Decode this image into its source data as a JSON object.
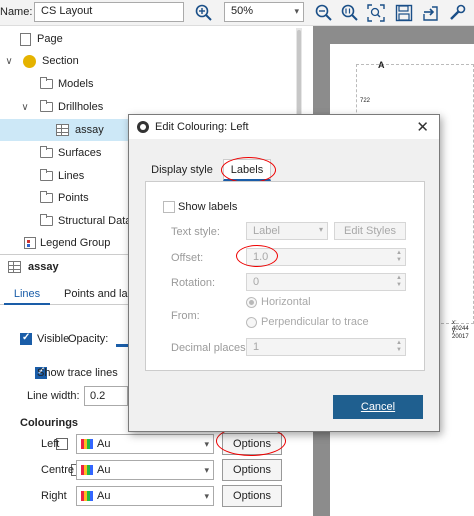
{
  "toolbar": {
    "name_label": "Name:",
    "name_value": "CS Layout",
    "zoom_value": "50%"
  },
  "tree": {
    "page": "Page",
    "section": "Section",
    "models": "Models",
    "drillholes": "Drillholes",
    "assay": "assay",
    "surfaces": "Surfaces",
    "lines": "Lines",
    "points": "Points",
    "structural_data": "Structural Data",
    "legend_group": "Legend Group"
  },
  "props": {
    "title": "assay",
    "tab_lines": "Lines",
    "tab_points": "Points and labels",
    "visible_label": "Visible",
    "opacity_label": "Opacity:",
    "show_trace_label": "Show trace lines",
    "line_width_label": "Line width:",
    "line_width_value": "0.2",
    "colourings_header": "Colourings",
    "rows": [
      {
        "label": "Left",
        "value": "Au",
        "button": "Options"
      },
      {
        "label": "Centre",
        "value": "Au",
        "button": "Options"
      },
      {
        "label": "Right",
        "value": "Au",
        "button": "Options"
      }
    ]
  },
  "view": {
    "label_a": "A",
    "tick_722": "722",
    "coord_x": "x: 40244",
    "coord_y": "y: 20017"
  },
  "dialog": {
    "title": "Edit Colouring: Left",
    "tab_display": "Display style",
    "tab_labels": "Labels",
    "show_labels": "Show labels",
    "text_style_label": "Text style:",
    "text_style_value": "Label",
    "edit_styles": "Edit Styles",
    "offset_label": "Offset:",
    "offset_value": "1.0",
    "rotation_label": "Rotation:",
    "rotation_value": "0",
    "from_label": "From:",
    "horizontal": "Horizontal",
    "perpendicular": "Perpendicular to trace",
    "decimal_label": "Decimal places:",
    "decimal_value": "1",
    "cancel": "Cancel"
  },
  "colors": {
    "accent": "#1a5da8",
    "annotation": "#e00000",
    "cancel_button": "#1f5f8f"
  }
}
